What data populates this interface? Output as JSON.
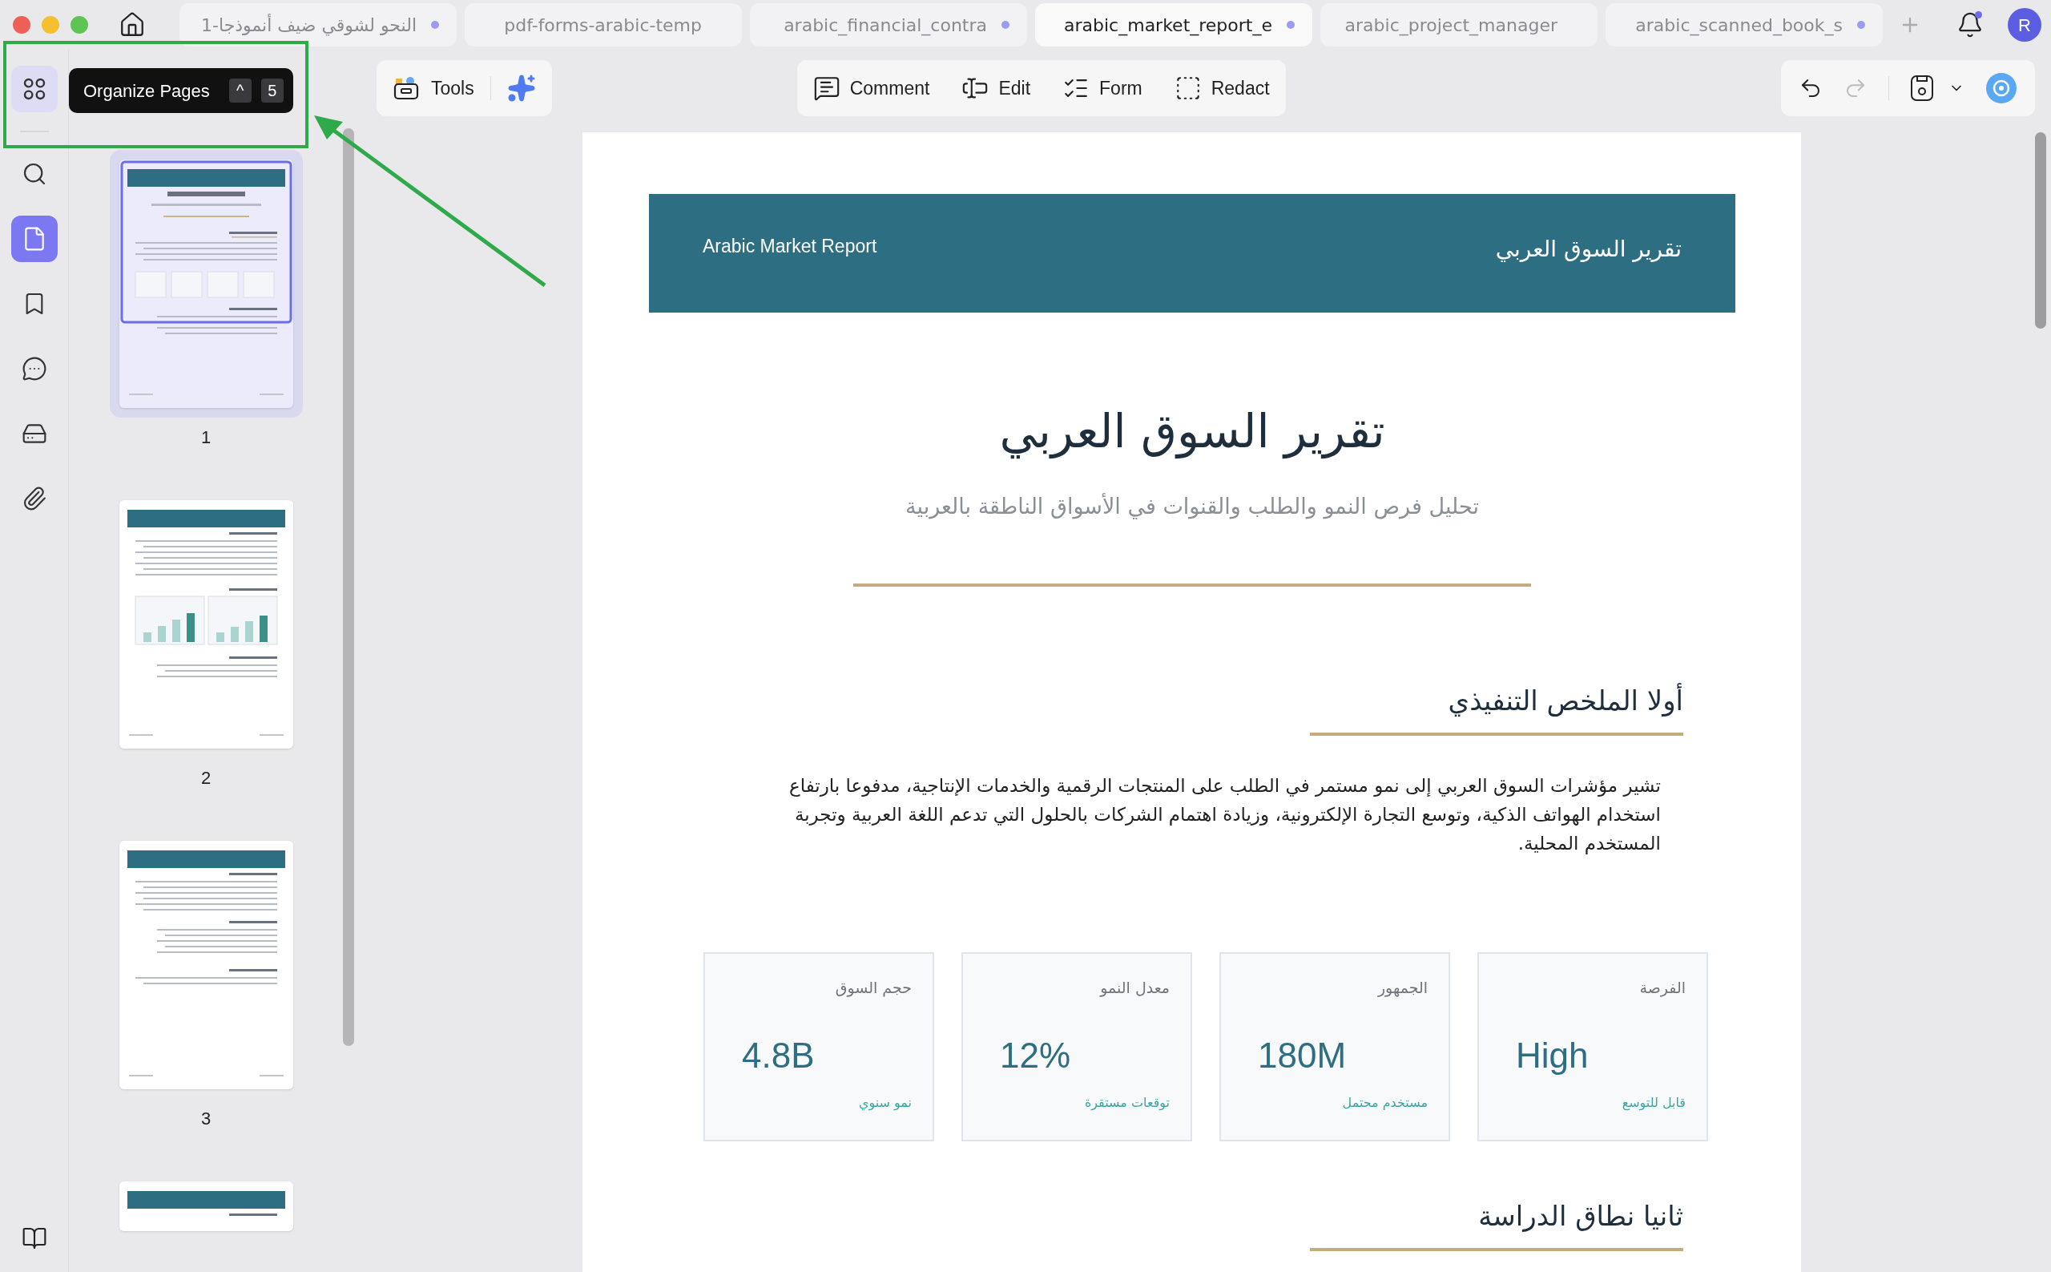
{
  "tabs": [
    {
      "label": "arabic_scanned_book_s",
      "selected": false,
      "modified": true
    },
    {
      "label": "arabic_project_manager",
      "selected": false,
      "modified": false
    },
    {
      "label": "arabic_market_report_e",
      "selected": true,
      "modified": true
    },
    {
      "label": "arabic_financial_contra",
      "selected": false,
      "modified": true
    },
    {
      "label": "pdf-forms-arabic-temp",
      "selected": false,
      "modified": false
    },
    {
      "label": "النحو لشوقي ضيف أنموذجا-1",
      "selected": false,
      "modified": true
    }
  ],
  "notifications": {
    "unread": true
  },
  "avatar": {
    "initial": "R"
  },
  "rail": [
    {
      "kind": "organize",
      "selected": false,
      "hovered": true
    },
    {
      "kind": "search",
      "selected": false,
      "hovered": false
    },
    {
      "kind": "pages",
      "selected": true,
      "hovered": false
    },
    {
      "kind": "bookmarks",
      "selected": false,
      "hovered": false
    },
    {
      "kind": "comments",
      "selected": false,
      "hovered": false
    },
    {
      "kind": "forms",
      "selected": false,
      "hovered": false
    },
    {
      "kind": "attachments",
      "selected": false,
      "hovered": false
    }
  ],
  "tooltip": {
    "label": "Organize Pages",
    "keys": [
      "5",
      "^"
    ]
  },
  "thumbnails": [
    {
      "label": "1",
      "selected": true,
      "kind": "cover"
    },
    {
      "label": "2",
      "selected": false,
      "kind": "charts"
    },
    {
      "label": "3",
      "selected": false,
      "kind": "text"
    },
    {
      "selected": false,
      "kind": "partial"
    }
  ],
  "toolbar": {
    "tools": {
      "label": "Tools"
    },
    "center": [
      {
        "kind": "redact",
        "label": "Redact"
      },
      {
        "kind": "form",
        "label": "Form"
      },
      {
        "kind": "edit",
        "label": "Edit"
      },
      {
        "kind": "comment",
        "label": "Comment"
      }
    ],
    "undo": {
      "disabled": false
    },
    "redo": {
      "disabled": true
    }
  },
  "document": {
    "header": {
      "left": "Arabic Market Report",
      "right": "تقرير السوق العربي"
    },
    "title": "تقرير السوق العربي",
    "subtitle": "تحليل فرص النمو والطلب والقنوات في الأسواق الناطقة بالعربية",
    "section_1": {
      "heading": "أولا الملخص التنفيذي",
      "paragraph": "تشير مؤشرات السوق العربي إلى نمو مستمر في الطلب على المنتجات الرقمية والخدمات الإنتاجية، مدفوعا بارتفاع استخدام الهواتف الذكية، وتوسع التجارة الإلكترونية، وزيادة اهتمام الشركات بالحلول التي تدعم اللغة العربية وتجربة المستخدم المحلية."
    },
    "cards": [
      {
        "label": "الفرصة",
        "value": "High",
        "note": "قابل للتوسع"
      },
      {
        "label": "الجمهور",
        "value": "180M",
        "note": "مستخدم محتمل"
      },
      {
        "label": "معدل النمو",
        "value": "12%",
        "note": "توقعات مستقرة"
      },
      {
        "label": "حجم السوق",
        "value": "4.8B",
        "note": "نمو سنوي"
      }
    ],
    "section_2": {
      "heading": "ثانيا نطاق الدراسة"
    }
  }
}
